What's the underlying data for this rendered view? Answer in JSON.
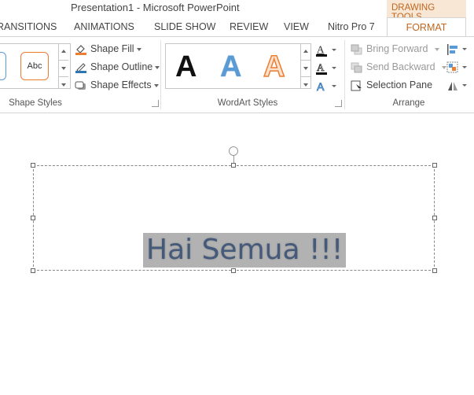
{
  "window": {
    "title": "Presentation1 - Microsoft PowerPoint",
    "context_tab_group": "DRAWING TOOLS"
  },
  "tabs": [
    "RANSITIONS",
    "ANIMATIONS",
    "SLIDE SHOW",
    "REVIEW",
    "VIEW",
    "Nitro Pro 7",
    "FORMAT"
  ],
  "shape_styles": {
    "preset_label": "Abc",
    "commands": [
      "Shape Fill",
      "Shape Outline",
      "Shape Effects"
    ],
    "group_label": "Shape Styles"
  },
  "wordart": {
    "samples": [
      "A",
      "A",
      "A"
    ],
    "colors": {
      "black": "#111111",
      "blue": "#5b9bd5",
      "orange": "#ed7d31"
    },
    "group_label": "WordArt Styles"
  },
  "arrange": {
    "commands": [
      "Bring Forward",
      "Send Backward",
      "Selection Pane"
    ],
    "group_label": "Arrange"
  },
  "slide": {
    "text": "Hai Semua !!!"
  },
  "colors": {
    "accent": "#c0661f",
    "context_bg": "#f8e7d5"
  }
}
